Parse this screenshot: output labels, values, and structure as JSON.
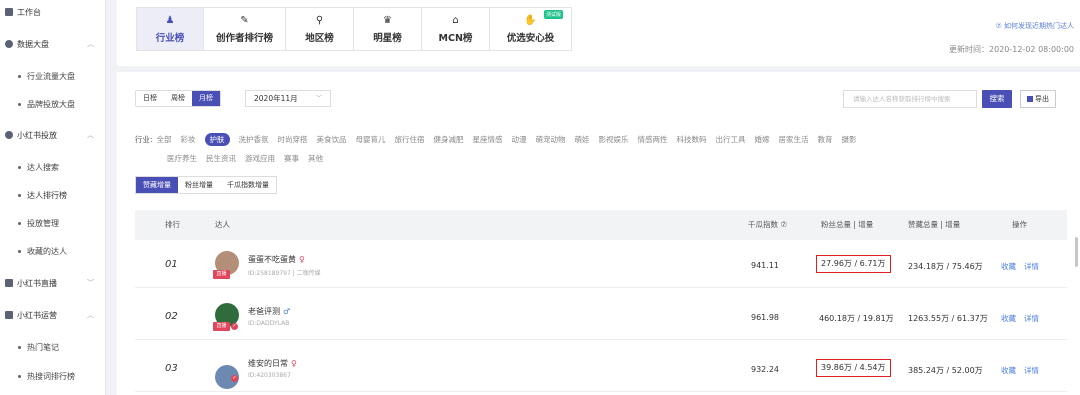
{
  "sidebar": {
    "workbench": "工作台",
    "data_dashboard": "数据大盘",
    "industry_traffic": "行业流量大盘",
    "brand_delivery": "品牌投放大盘",
    "xhs_delivery": "小红书投放",
    "influencer_search": "达人搜索",
    "influencer_ranking": "达人排行榜",
    "delivery_mgmt": "投放管理",
    "favorites": "收藏的达人",
    "xhs_live": "小红书直播",
    "xhs_ops": "小红书运营",
    "hot_notes": "热门笔记",
    "hot_words": "热搜词排行榜"
  },
  "tabs": [
    {
      "label": "行业榜",
      "icon": "person-icon",
      "glyph": "♟"
    },
    {
      "label": "创作者排行榜",
      "icon": "brush-icon",
      "glyph": "✎"
    },
    {
      "label": "地区榜",
      "icon": "location-icon",
      "glyph": "⚲"
    },
    {
      "label": "明星榜",
      "icon": "crown-icon",
      "glyph": "♛"
    },
    {
      "label": "MCN榜",
      "icon": "building-icon",
      "glyph": "⌂"
    },
    {
      "label": "优选安心投",
      "icon": "hand-icon",
      "glyph": "✋",
      "badge": "测试版"
    }
  ],
  "header": {
    "how_link": "⑦ 如何发现近期热门达人",
    "update_time": "更新时间：2020-12-02 08:00:00"
  },
  "filters": {
    "period": [
      "日榜",
      "周榜",
      "月榜"
    ],
    "month": "2020年11月",
    "search_placeholder": "请输入达人名称获取排行榜中搜索",
    "search_button": "搜索",
    "export_button": "导出",
    "industry_label": "行业:",
    "industries_line1": [
      "全部",
      "彩妆",
      "护肤",
      "洗护香氛",
      "时尚穿搭",
      "美食饮品",
      "母婴育儿",
      "旅行住宿",
      "健身减肥",
      "星座情感",
      "动漫",
      "萌宠动物",
      "萌娃",
      "影视娱乐",
      "情感两性",
      "科技数码",
      "出行工具",
      "婚嫁",
      "居家生活",
      "教育",
      "摄影"
    ],
    "industries_line2": [
      "医疗养生",
      "民生资讯",
      "游戏应用",
      "赛事",
      "其他"
    ],
    "sort_options": [
      "赞藏增量",
      "粉丝增量",
      "千瓜指数增量"
    ]
  },
  "table": {
    "headers": {
      "rank": "排行",
      "influencer": "达人",
      "index": "千瓜指数 ⑦",
      "fans": "粉丝总量 | 增量",
      "likes": "赞藏总量 | 增量",
      "ops": "操作"
    },
    "rows": [
      {
        "rank": "01",
        "name": "蛋蛋不吃蛋黄",
        "gender": "♀",
        "uid": "ID:258189797 | 二咖传媒",
        "index": "941.11",
        "fans": "27.96万 / 6.71万",
        "likes": "234.18万 / 75.46万",
        "badge": "直播"
      },
      {
        "rank": "02",
        "name": "老爸评测",
        "gender": "♂",
        "uid": "ID:DADDYLAB",
        "index": "961.98",
        "fans": "460.18万 / 19.81万",
        "likes": "1263.55万 / 61.37万",
        "badge": "直播"
      },
      {
        "rank": "03",
        "name": "维安的日常",
        "gender": "♀",
        "uid": "ID:420303867",
        "index": "932.24",
        "fans": "39.86万 / 4.54万",
        "likes": "385.24万 / 52.00万",
        "badge": ""
      }
    ],
    "op_fav": "收藏",
    "op_detail": "详情"
  }
}
